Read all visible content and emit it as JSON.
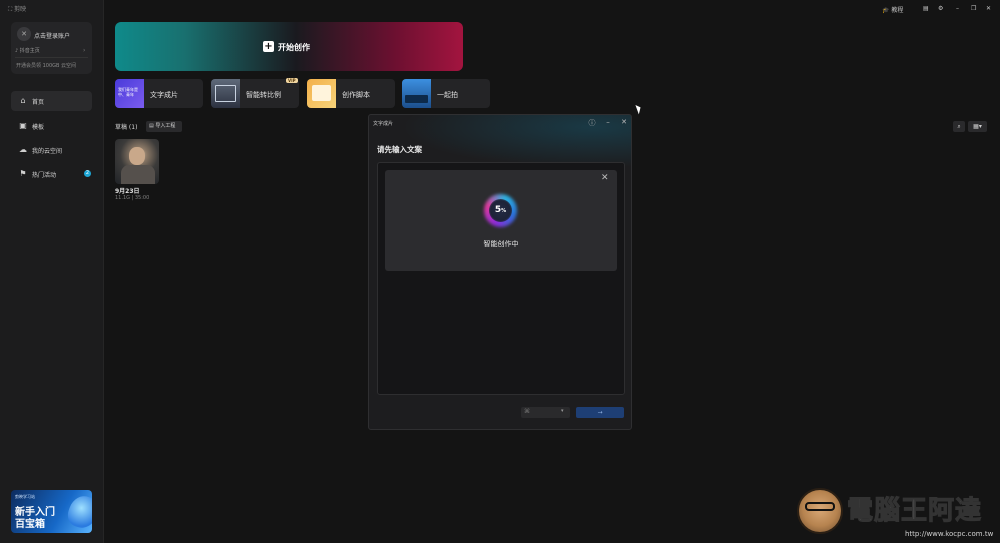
{
  "app": {
    "logo_text": "剪映"
  },
  "topbar": {
    "tutorial": "教程",
    "tutorial_icon": "graduation-icon",
    "message_icon": "message-icon",
    "settings_icon": "settings-icon",
    "minimize": "–",
    "restore": "❐",
    "close": "✕"
  },
  "account": {
    "login_prompt": "点击登录账户",
    "douyin_home": "抖音主页",
    "storage_promo": "开通会员领 100GB 云空间"
  },
  "sidebar": {
    "items": [
      {
        "label": "首页",
        "icon": "home-icon",
        "glyph": "⌂",
        "active": true
      },
      {
        "label": "模板",
        "icon": "template-icon",
        "glyph": "▣",
        "active": false
      },
      {
        "label": "我的云空间",
        "icon": "cloud-icon",
        "glyph": "☁",
        "active": false
      },
      {
        "label": "热门活动",
        "icon": "flag-icon",
        "glyph": "⚑",
        "active": false,
        "badge": "2"
      }
    ],
    "promo": {
      "tag": "剪映学习站",
      "line1": "新手入门",
      "line2": "百宝箱"
    }
  },
  "hero": {
    "label": "开始创作"
  },
  "tools": [
    {
      "label": "文字成片",
      "thumb_text": "我们青年是中、青年"
    },
    {
      "label": "智能转比例",
      "badge": "VIP"
    },
    {
      "label": "创作脚本"
    },
    {
      "label": "一起拍"
    }
  ],
  "drafts": {
    "title": "草稿 (1)",
    "import_label": "导入工程",
    "items": [
      {
        "date": "9月23日",
        "meta": "11.1G | 35:00"
      }
    ]
  },
  "dialog": {
    "title": "文字成片",
    "heading": "请先输入文案",
    "progress_value": "5",
    "progress_unit": "%",
    "progress_fraction": 0.05,
    "progress_label": "智能创作中",
    "confirm_label": "→"
  },
  "watermark": {
    "text": "電腦王阿達",
    "url": "http://www.kocpc.com.tw"
  },
  "colors": {
    "accent_teal": "#0f8a8a",
    "accent_crimson": "#a3143f",
    "badge_blue": "#1ea7d6",
    "confirm_blue": "#1e3f75"
  }
}
